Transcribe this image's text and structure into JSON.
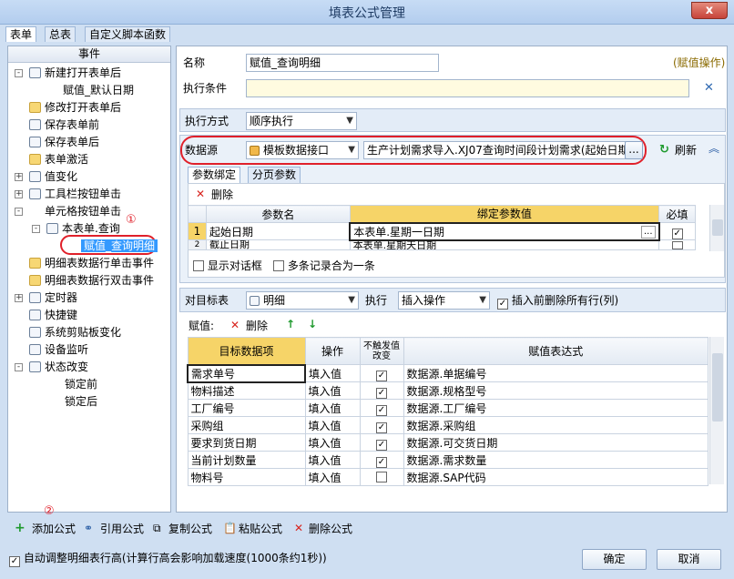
{
  "window": {
    "title": "填表公式管理",
    "close": "x"
  },
  "tabs": [
    "表单",
    "总表",
    "自定义脚本函数"
  ],
  "left": {
    "header": "事件",
    "nodes": [
      "新建打开表单后",
      "赋值_默认日期",
      "修改打开表单后",
      "保存表单前",
      "保存表单后",
      "表单激活",
      "值变化",
      "工具栏按钮单击",
      "单元格按钮单击",
      "本表单.查询",
      "赋值_查询明细",
      "明细表数据行单击事件",
      "明细表数据行双击事件",
      "定时器",
      "快捷键",
      "系统剪贴板变化",
      "设备监听",
      "状态改变",
      "锁定前",
      "锁定后"
    ],
    "marker1": "①"
  },
  "form": {
    "name_label": "名称",
    "name_value": "赋值_查询明细",
    "op_type": "(赋值操作)",
    "cond_label": "执行条件",
    "exec_label": "执行方式",
    "exec_value": "顺序执行",
    "ds_label": "数据源",
    "ds_value": "模板数据接口",
    "ds_path": "生产计划需求导入.XJ07查询时间段计划需求(起始日期",
    "ds_btn": "...",
    "refresh": "刷新"
  },
  "param": {
    "tabs": [
      "参数绑定",
      "分页参数"
    ],
    "delete": "删除",
    "headers": [
      "参数名",
      "绑定参数值",
      "必填"
    ],
    "rows": [
      {
        "n": "1",
        "name": "起始日期",
        "val": "本表单.星期一日期"
      },
      {
        "n": "2",
        "name": "截止日期",
        "val": "本表单.星期天日期"
      }
    ],
    "show_dialog": "显示对话框",
    "merge": "多条记录合为一条"
  },
  "target": {
    "label": "对目标表",
    "value": "明细",
    "exec_label": "执行",
    "exec_value": "插入操作",
    "clear": "插入前删除所有行(列)",
    "assign_label": "赋值:",
    "delete": "删除",
    "headers": [
      "目标数据项",
      "操作",
      "不触发值改变",
      "赋值表达式"
    ],
    "rows": [
      [
        "需求单号",
        "填入值",
        true,
        "数据源.单据编号"
      ],
      [
        "物料描述",
        "填入值",
        true,
        "数据源.规格型号"
      ],
      [
        "工厂编号",
        "填入值",
        true,
        "数据源.工厂编号"
      ],
      [
        "采购组",
        "填入值",
        true,
        "数据源.采购组"
      ],
      [
        "要求到货日期",
        "填入值",
        true,
        "数据源.可交货日期"
      ],
      [
        "当前计划数量",
        "填入值",
        true,
        "数据源.需求数量"
      ],
      [
        "物料号",
        "填入值",
        false,
        "数据源.SAP代码"
      ]
    ]
  },
  "toolbar": {
    "marker2": "②",
    "add": "添加公式",
    "ref": "引用公式",
    "copy": "复制公式",
    "paste": "粘贴公式",
    "del": "删除公式"
  },
  "footer": {
    "auto": "自动调整明细表行高(计算行高会影响加载速度(1000条约1秒))",
    "ok": "确定",
    "cancel": "取消"
  }
}
